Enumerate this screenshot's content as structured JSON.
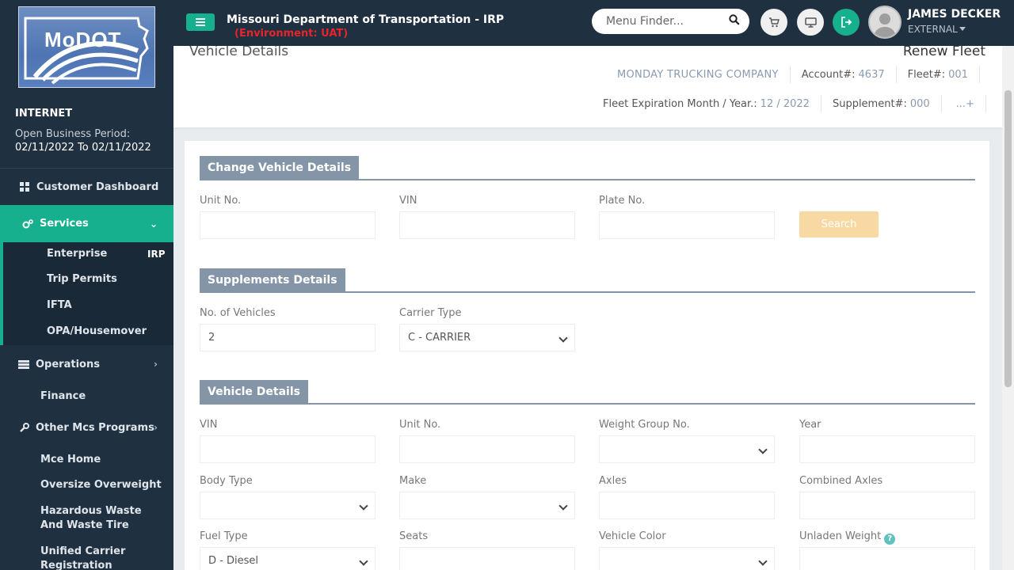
{
  "header": {
    "logo_text": "MoDOT",
    "title": "Missouri Department of Transportation - IRP",
    "environment": "(Environment: UAT)",
    "search_placeholder": "Menu Finder...",
    "user_name": "JAMES DECKER",
    "user_role": "EXTERNAL"
  },
  "sidebar": {
    "channel": "INTERNET",
    "period_label": "Open Business Period:",
    "period": "02/11/2022 To 02/11/2022",
    "items": [
      {
        "label": "Customer Dashboard",
        "icon": "dashboard-icon"
      },
      {
        "label": "Services",
        "icon": "cogs-icon"
      },
      {
        "label": "Operations",
        "icon": "operations-icon"
      },
      {
        "label": "Finance"
      },
      {
        "label": "Other Mcs Programs",
        "icon": "wrench-icon"
      },
      {
        "label": "Mce Home"
      },
      {
        "label": "Oversize Overweight"
      },
      {
        "label": "Hazardous Waste And Waste Tire"
      },
      {
        "label": "Unified Carrier Registration"
      }
    ],
    "submenu": [
      {
        "label": "Enterprise",
        "badge": "IRP"
      },
      {
        "label": "Trip Permits"
      },
      {
        "label": "IFTA"
      },
      {
        "label": "OPA/Housemover"
      }
    ]
  },
  "summary": {
    "title": "Vehicle Details",
    "action": "Renew Fleet",
    "company": "MONDAY TRUCKING COMPANY",
    "account_label": "Account#:",
    "account": "4637",
    "fleet_label": "Fleet#:",
    "fleet": "001",
    "expiration_label": "Fleet Expiration Month / Year.:",
    "expiration": "12 / 2022",
    "supplement_label": "Supplement#:",
    "supplement": "000",
    "more": "...+"
  },
  "change_vehicle": {
    "heading": "Change Vehicle Details",
    "unit_label": "Unit No.",
    "vin_label": "VIN",
    "plate_label": "Plate No.",
    "search_label": "Search"
  },
  "supplements": {
    "heading": "Supplements Details",
    "vehicles_label": "No. of Vehicles",
    "vehicles_value": "2",
    "carrier_label": "Carrier Type",
    "carrier_value": "C - CARRIER"
  },
  "vehicle": {
    "heading": "Vehicle Details",
    "vin_label": "VIN",
    "unit_label": "Unit No.",
    "weight_label": "Weight Group No.",
    "year_label": "Year",
    "body_label": "Body Type",
    "make_label": "Make",
    "axles_label": "Axles",
    "combined_label": "Combined Axles",
    "fuel_label": "Fuel Type",
    "fuel_value": "D - Diesel",
    "seats_label": "Seats",
    "color_label": "Vehicle Color",
    "unladen_label": "Unladen Weight"
  },
  "colors": {
    "topbar": "#1f3040",
    "accent": "#16b08f",
    "section": "#8495a8",
    "env": "#e8242b"
  }
}
